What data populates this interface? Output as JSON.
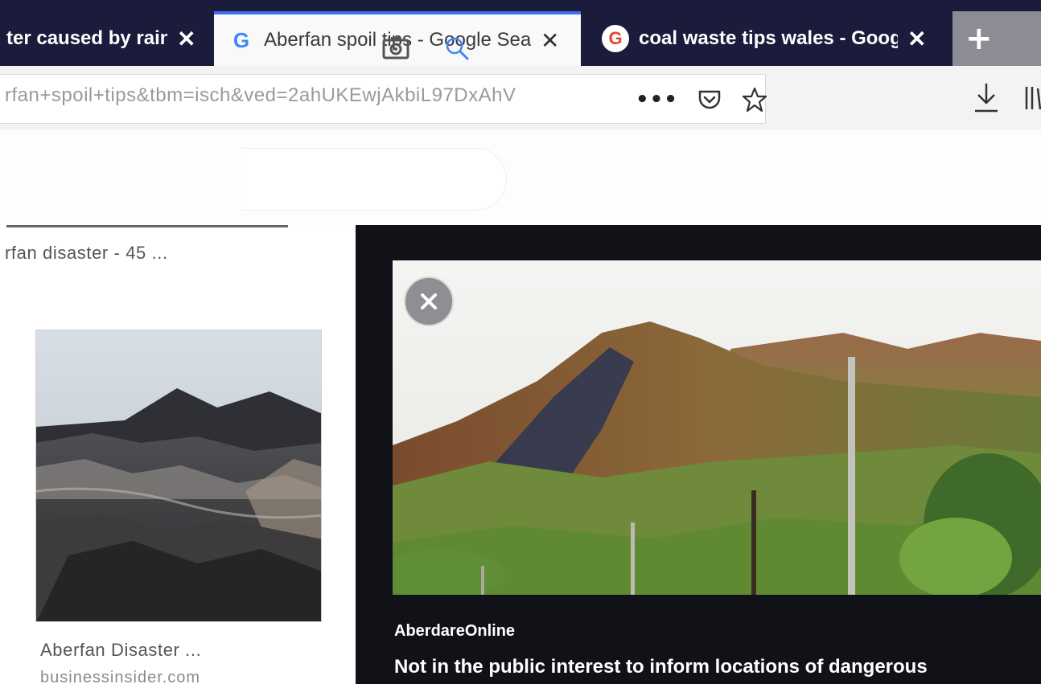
{
  "colors": {
    "tabstrip_bg": "#1b1b3c",
    "active_tab_bg": "#f9f9fa",
    "active_tab_accent": "#3a6ff0",
    "panel_bg": "#101217",
    "google_blue": "#4285f4",
    "google_red": "#e94235"
  },
  "tabs": [
    {
      "title": "ter caused by rain",
      "close": "✕",
      "active": false
    },
    {
      "title": "Aberfan spoil tips - Google Search",
      "icon": "google-g-icon",
      "close": "✕",
      "active": true
    },
    {
      "title": "coal waste tips wales - Google",
      "icon": "google-g-icon",
      "close": "✕",
      "active": false
    }
  ],
  "new_tab_label": "+",
  "toolbar": {
    "url": "rfan+spoil+tips&tbm=isch&ved=2ahUKEwjAkbiL97DxAhV",
    "more_label": "•••",
    "icons": [
      "pocket-icon",
      "bookmark-star-icon",
      "download-icon",
      "library-icon"
    ]
  },
  "search": {
    "icons": [
      "camera-icon",
      "search-icon"
    ]
  },
  "left_column": {
    "caption": "rfan disaster - 45 ...",
    "result": {
      "title": "Aberfan Disaster ...",
      "source": "businessinsider.com"
    }
  },
  "preview_panel": {
    "close_icon": "close-icon",
    "site_name": "AberdareOnline",
    "result_title": "Not in the public interest to inform locations of dangerous"
  }
}
